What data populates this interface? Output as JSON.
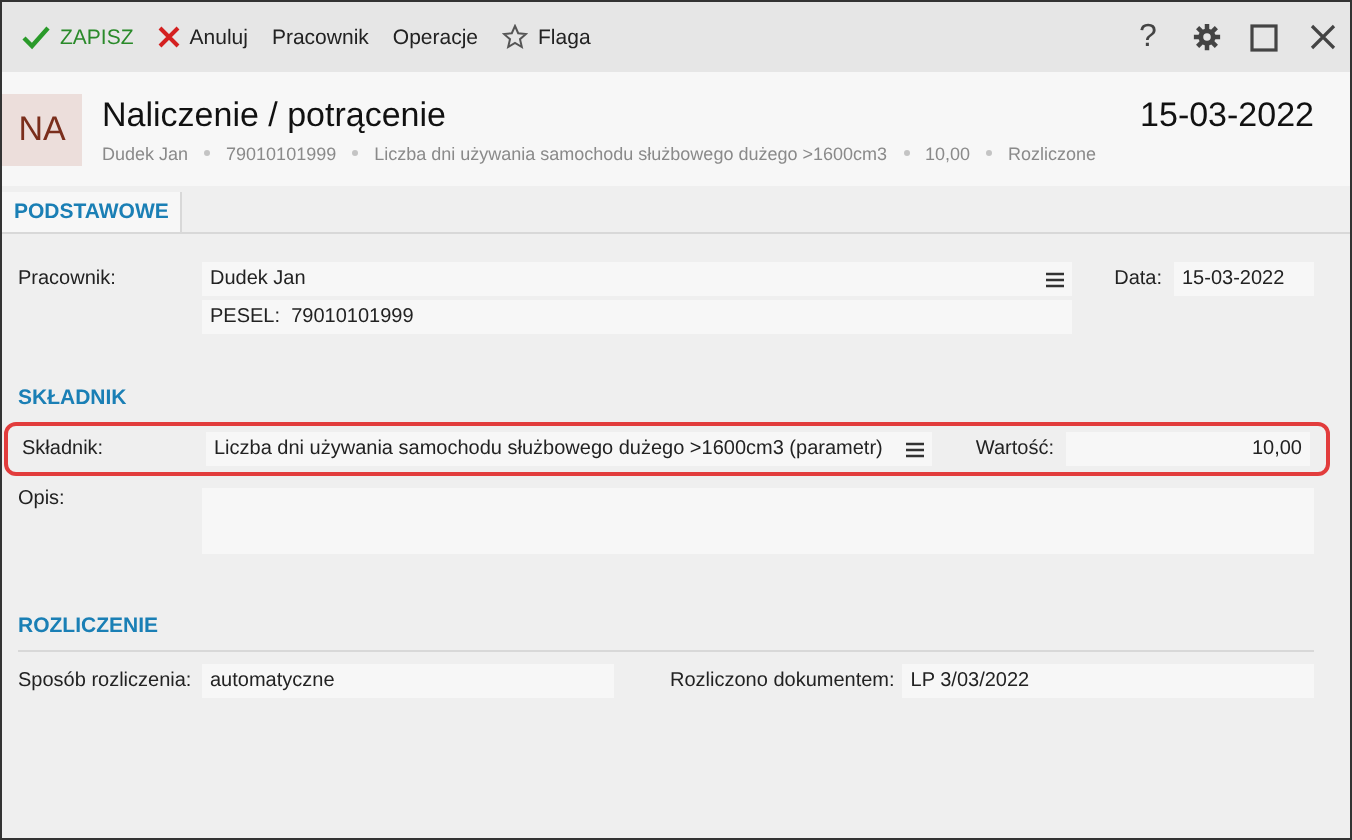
{
  "toolbar": {
    "actions": [
      {
        "kind": "save",
        "label": "ZAPISZ"
      },
      {
        "kind": "cancel",
        "label": "Anuluj"
      },
      {
        "kind": "plain",
        "label": "Pracownik"
      },
      {
        "kind": "plain",
        "label": "Operacje"
      },
      {
        "kind": "flag",
        "label": "Flaga"
      }
    ],
    "help": "?"
  },
  "header": {
    "badge": "NA",
    "title": "Naliczenie / potrącenie",
    "date": "15-03-2022",
    "details": [
      "Dudek Jan",
      "79010101999",
      "Liczba dni używania samochodu służbowego dużego >1600cm3",
      "10,00",
      "Rozliczone"
    ]
  },
  "tabs": [
    {
      "label": "PODSTAWOWE",
      "selected": true
    }
  ],
  "employee": {
    "label": "Pracownik:",
    "value": "Dudek Jan",
    "pesel_label": "PESEL:",
    "pesel": "79010101999",
    "date_label": "Data:",
    "date": "15-03-2022"
  },
  "component_section": {
    "title": "SKŁADNIK",
    "highlighted": true,
    "label": "Składnik:",
    "value": "Liczba dni używania samochodu służbowego dużego >1600cm3 (parametr)",
    "amount_label": "Wartość:",
    "amount": "10,00",
    "description_label": "Opis:"
  },
  "settlement_section": {
    "title": "ROZLICZENIE",
    "method_label": "Sposób rozliczenia:",
    "method": "automatyczne",
    "document_label": "Rozliczono dokumentem:",
    "document": "LP 3/03/2022"
  }
}
